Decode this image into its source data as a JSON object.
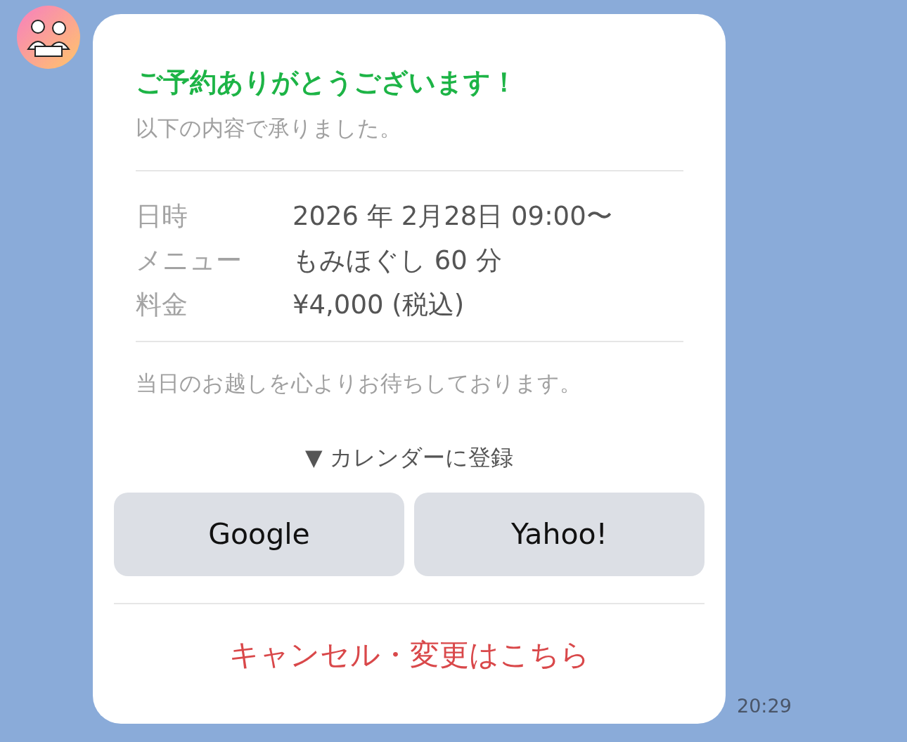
{
  "message": {
    "title": "ご予約ありがとうございます！",
    "subtitle": "以下の内容で承りました。",
    "details": [
      {
        "label": "日時",
        "value": "2026 年 2月28日 09:00〜"
      },
      {
        "label": "メニュー",
        "value": "もみほぐし 60 分"
      },
      {
        "label": "料金",
        "value": "¥4,000 (税込)"
      }
    ],
    "note": "当日のお越しを心よりお待ちしております。",
    "calendar_heading": "▼ カレンダーに登録",
    "buttons": [
      "Google",
      "Yahoo!"
    ],
    "link": "キャンセル・変更はこちら"
  },
  "time": "20:29"
}
